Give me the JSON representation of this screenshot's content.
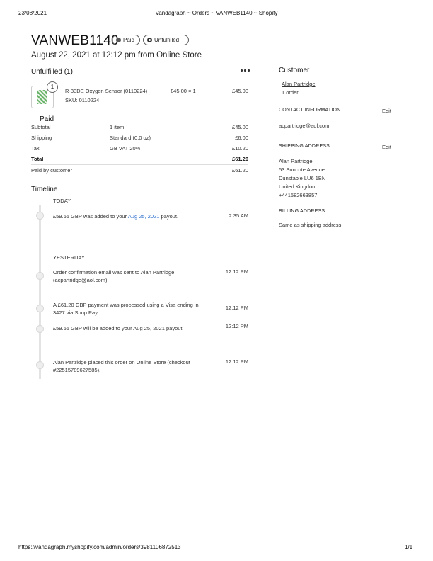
{
  "print_header": {
    "date": "23/08/2021",
    "page_title": "Vandagraph ~ Orders ~ VANWEB1140 ~ Shopify"
  },
  "print_footer": {
    "url": "https://vandagraph.myshopify.com/admin/orders/3981106872513",
    "page_number": "1/1"
  },
  "order": {
    "title": "VANWEB1140",
    "payment_badge": "Paid",
    "fulfillment_badge": "Unfulfilled",
    "subtitle": "August 22, 2021 at 12:12 pm from Online Store"
  },
  "fulfillment": {
    "title": "Unfulfilled (1)",
    "item": {
      "quantity_badge": "1",
      "name": "R-33DE Oxygen Sensor (0110224)",
      "sku": "SKU: 0110224",
      "unit_price": "£45.00 × 1",
      "total": "£45.00"
    }
  },
  "payment": {
    "title": "Paid",
    "rows": [
      {
        "label": "Subtotal",
        "detail": "1 item",
        "amount": "£45.00"
      },
      {
        "label": "Shipping",
        "detail": "Standard (0.0 oz)",
        "amount": "£6.00"
      },
      {
        "label": "Tax",
        "detail": "GB VAT 20%",
        "amount": "£10.20"
      },
      {
        "label": "Total",
        "detail": "",
        "amount": "£61.20"
      }
    ],
    "paid_by_label": "Paid by customer",
    "paid_by_amount": "£61.20"
  },
  "timeline": {
    "title": "Timeline",
    "today_label": "TODAY",
    "yesterday_label": "YESTERDAY",
    "today_event": {
      "text_before": "£59.65 GBP was added to your ",
      "link": "Aug 25, 2021",
      "text_after": " payout.",
      "time": "2:35 AM"
    },
    "events": [
      {
        "text": "Order confirmation email was sent to Alan Partridge (acpartridge@aol.com).",
        "time": "12:12 PM"
      },
      {
        "text": "A £61.20 GBP payment was processed using a Visa ending in 3427 via Shop Pay.",
        "time": "12:12 PM"
      },
      {
        "text": "£59.65 GBP will be added to your Aug 25, 2021 payout.",
        "time": "12:12 PM"
      },
      {
        "text": "Alan Partridge placed this order on Online Store (checkout #22515789627585).",
        "time": "12:12 PM"
      }
    ]
  },
  "customer": {
    "title": "Customer",
    "name": "Alan Partridge",
    "orders": "1 order",
    "contact_label": "CONTACT INFORMATION",
    "contact_edit": "Edit",
    "email": "acpartridge@aol.com",
    "shipping_label": "SHIPPING ADDRESS",
    "shipping_edit": "Edit",
    "address": [
      "Alan Partridge",
      "53 Suncote Avenue",
      "Dunstable LU6 1BN",
      "United Kingdom",
      "+441582663857"
    ],
    "billing_label": "BILLING ADDRESS",
    "billing_text": "Same as shipping address"
  }
}
